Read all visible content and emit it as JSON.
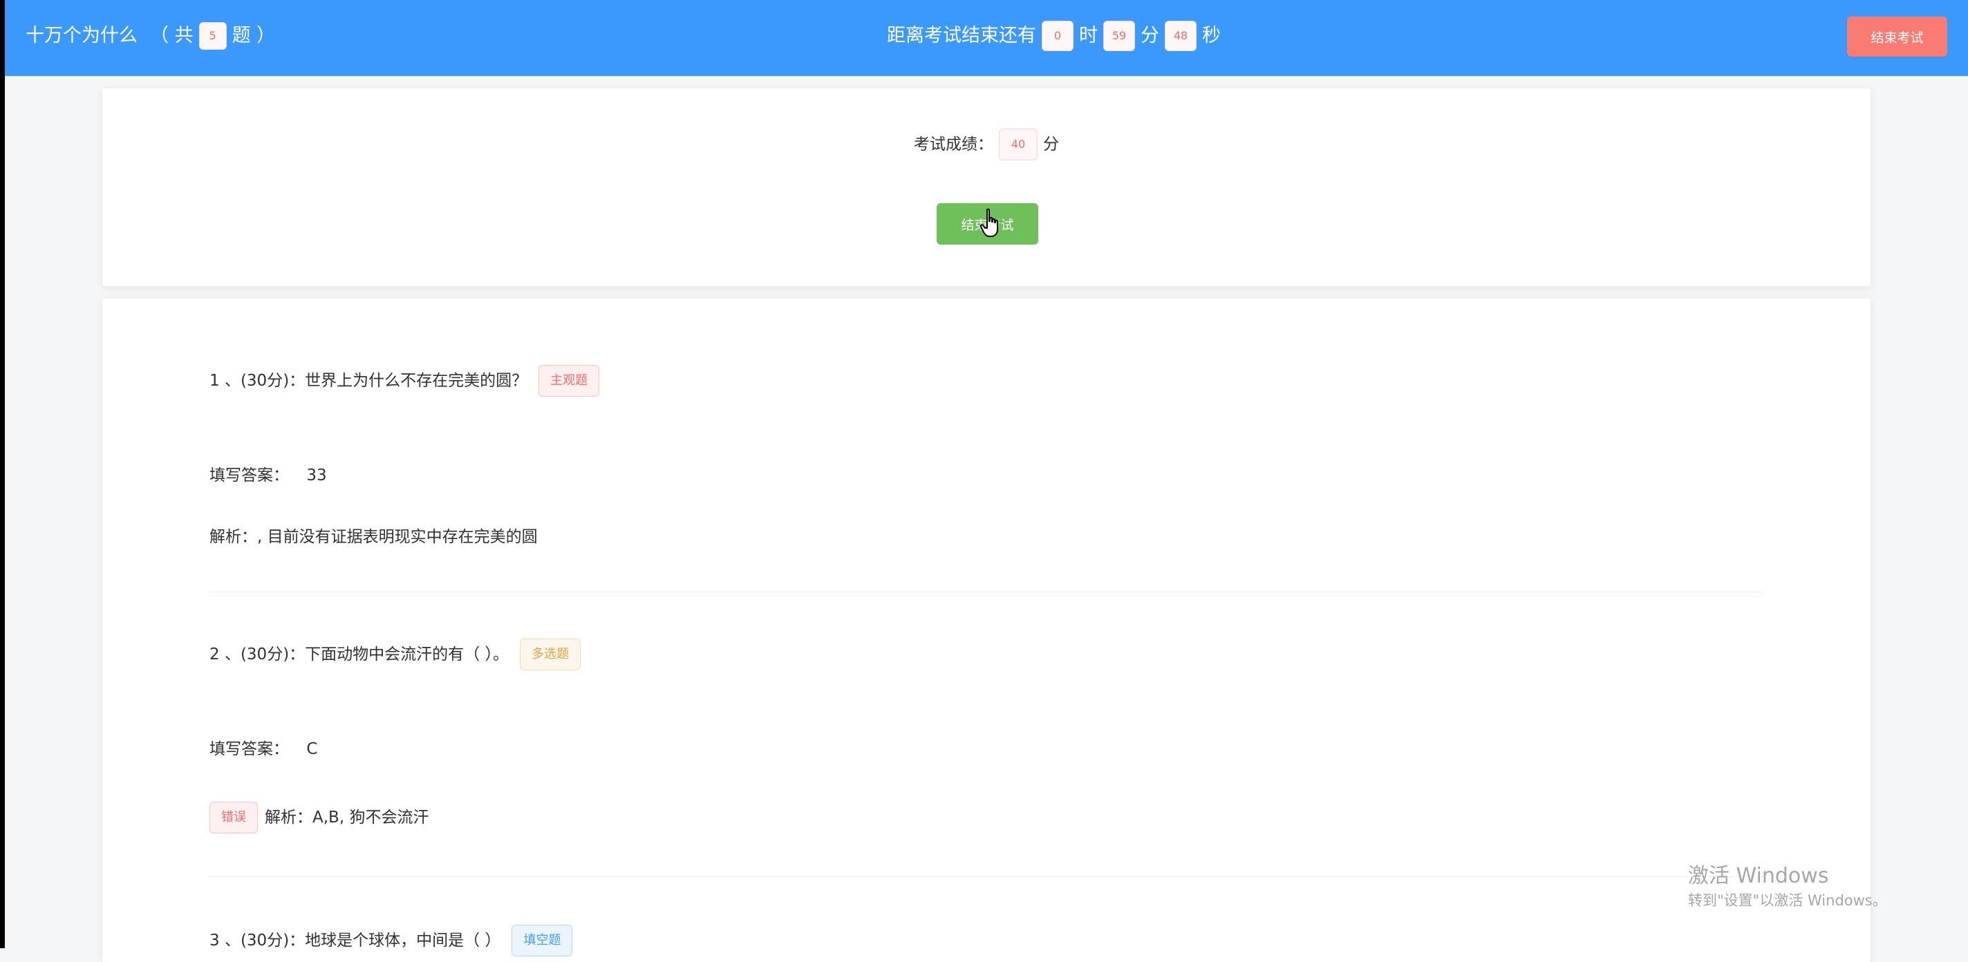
{
  "header": {
    "title": "十万个为什么",
    "total_prefix": "（ 共",
    "total_count": "5",
    "total_suffix": "题 ）",
    "countdown_label": "距离考试结束还有",
    "hours": "0",
    "hours_unit": "时",
    "minutes": "59",
    "minutes_unit": "分",
    "seconds": "48",
    "seconds_unit": "秒",
    "end_button": "结束考试"
  },
  "score": {
    "label": "考试成绩：",
    "value": "40",
    "unit": "分",
    "finish_button": "结束考试"
  },
  "questions": [
    {
      "index": "1",
      "title": "、(30分)：世界上为什么不存在完美的圆？",
      "type_tag": "主观题",
      "answer_label": "填写答案：",
      "answer_value": "33",
      "analysis": "解析：, 目前没有证据表明现实中存在完美的圆"
    },
    {
      "index": "2",
      "title": "、(30分)：下面动物中会流汗的有（ ）。",
      "type_tag": "多选题",
      "answer_label": "填写答案：",
      "answer_value": "C",
      "result_tag": "错误",
      "analysis": "解析：A,B, 狗不会流汗"
    },
    {
      "index": "3",
      "title": "、(30分)：地球是个球体，中间是（ ）",
      "type_tag": "填空题"
    }
  ],
  "watermark": {
    "title": "激活 Windows",
    "subtitle": "转到\"设置\"以激活 Windows。"
  },
  "colors": {
    "header_bg": "#3b99fd",
    "end_button_bg": "#fa7b73",
    "finish_button_bg": "#6fbf5a",
    "danger": "#f56c6c",
    "warning": "#e6a23c",
    "primary": "#409eff"
  }
}
